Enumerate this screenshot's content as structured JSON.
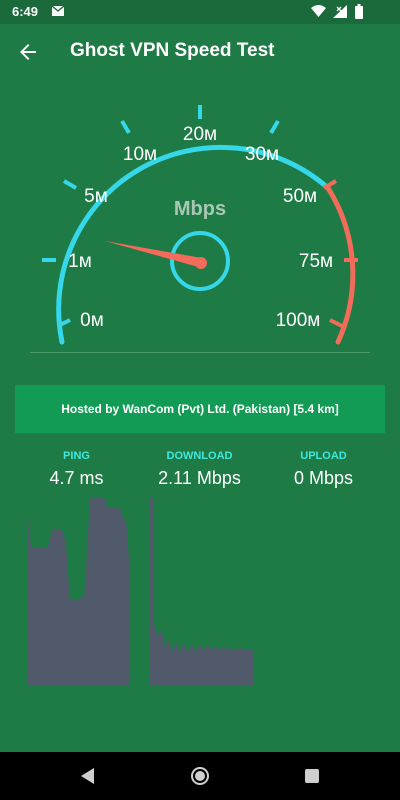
{
  "status_bar": {
    "time": "6:49",
    "icons": [
      "mail-icon",
      "wifi-icon",
      "signal-icon",
      "battery-icon"
    ]
  },
  "app_bar": {
    "title": "Ghost VPN Speed Test",
    "back_icon": "arrow-left-icon"
  },
  "gauge": {
    "unit_label": "Mbps",
    "tick_labels": [
      "0м",
      "1м",
      "5м",
      "10м",
      "20м",
      "30м",
      "50м",
      "75м",
      "100м"
    ],
    "needle_value": "1м",
    "colors": {
      "normal_arc": "#35d7e8",
      "high_arc": "#f26b5b",
      "needle": "#f26b5b"
    }
  },
  "server": {
    "hosted_by": "Hosted by WanCom (Pvt) Ltd. (Pakistan) [5.4 km]"
  },
  "stats": {
    "ping": {
      "label": "PING",
      "value": "4.7 ms"
    },
    "download": {
      "label": "DOWNLOAD",
      "value": "2.11 Mbps"
    },
    "upload": {
      "label": "UPLOAD",
      "value": "0 Mbps"
    }
  },
  "colors": {
    "background": "#1e7b45",
    "banner": "#129b55",
    "stat_label": "#3fe8e0",
    "graph_fill": "#515a6a"
  },
  "nav_bar": {
    "icons": [
      "back-triangle-icon",
      "home-circle-icon",
      "recents-square-icon"
    ]
  }
}
